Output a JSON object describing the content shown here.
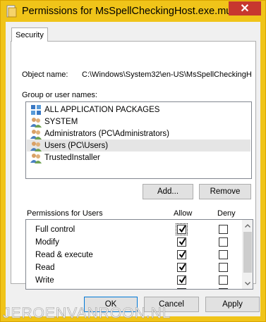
{
  "window": {
    "title": "Permissions for MsSpellCheckingHost.exe.mui",
    "close_glyph": "✕",
    "frame_color": "#f0c419"
  },
  "tabs": [
    {
      "label": "Security"
    }
  ],
  "object": {
    "label": "Object name:",
    "value": "C:\\Windows\\System32\\en-US\\MsSpellCheckingH"
  },
  "groups": {
    "label": "Group or user names:",
    "items": [
      {
        "label": "ALL APPLICATION PACKAGES",
        "icon": "packages-icon",
        "selected": false
      },
      {
        "label": "SYSTEM",
        "icon": "users-icon",
        "selected": false
      },
      {
        "label": "Administrators (PC\\Administrators)",
        "icon": "users-icon",
        "selected": false
      },
      {
        "label": "Users (PC\\Users)",
        "icon": "users-icon",
        "selected": true
      },
      {
        "label": "TrustedInstaller",
        "icon": "users-icon",
        "selected": false
      }
    ]
  },
  "buttons": {
    "add": "Add...",
    "remove": "Remove",
    "ok": "OK",
    "cancel": "Cancel",
    "apply": "Apply"
  },
  "permissions": {
    "label": "Permissions for Users",
    "allow_header": "Allow",
    "deny_header": "Deny",
    "rows": [
      {
        "name": "Full control",
        "allow": true,
        "deny": false
      },
      {
        "name": "Modify",
        "allow": true,
        "deny": false
      },
      {
        "name": "Read & execute",
        "allow": true,
        "deny": false
      },
      {
        "name": "Read",
        "allow": true,
        "deny": false
      },
      {
        "name": "Write",
        "allow": true,
        "deny": false
      }
    ]
  },
  "watermark": "JEROENVANROON.NL"
}
